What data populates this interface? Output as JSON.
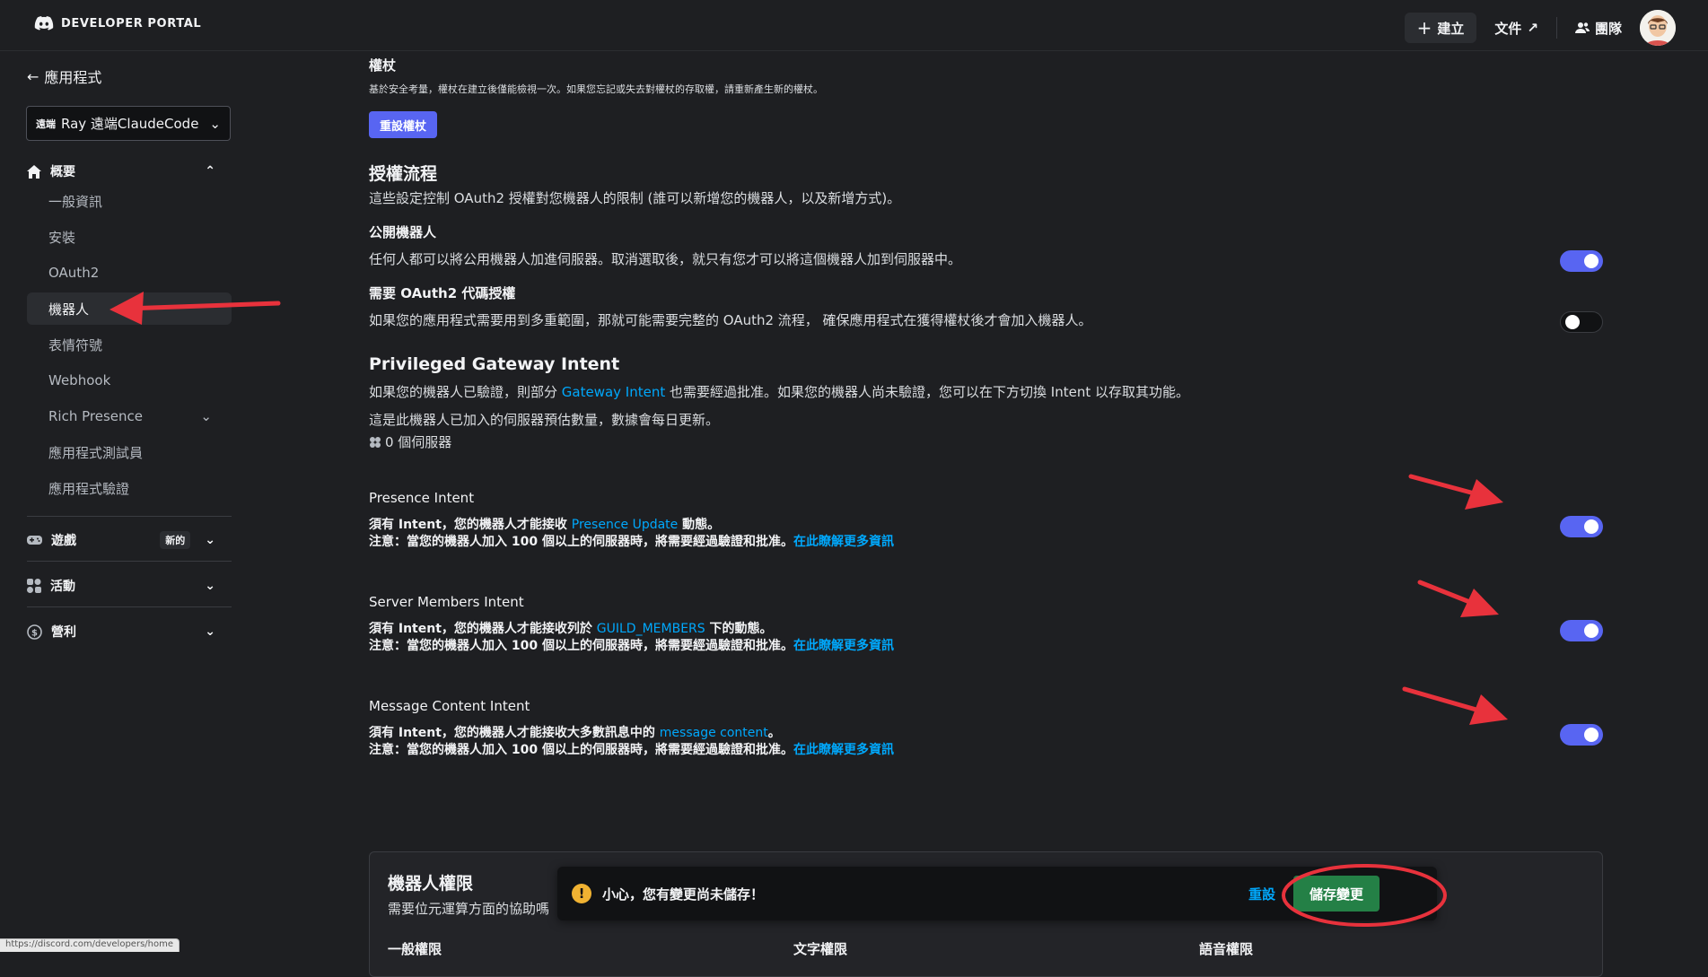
{
  "header": {
    "brand": "DEVELOPER PORTAL",
    "create_label": "建立",
    "docs_label": "文件",
    "team_label": "團隊"
  },
  "sidebar": {
    "back_label": "應用程式",
    "app_selector": {
      "prefix": "遠端",
      "name": "Ray 遠端ClaudeCode"
    },
    "overview_heading": "概要",
    "items": [
      {
        "label": "一般資訊"
      },
      {
        "label": "安裝"
      },
      {
        "label": "OAuth2"
      },
      {
        "label": "機器人"
      },
      {
        "label": "表情符號"
      },
      {
        "label": "Webhook"
      },
      {
        "label": "Rich Presence"
      },
      {
        "label": "應用程式測試員"
      },
      {
        "label": "應用程式驗證"
      }
    ],
    "games_heading": "遊戲",
    "games_badge": "新的",
    "activities_heading": "活動",
    "monetization_heading": "營利"
  },
  "main": {
    "token": {
      "title": "權杖",
      "desc": "基於安全考量，權杖在建立後僅能檢視一次。如果您忘記或失去對權杖的存取權，請重新產生新的權杖。",
      "reset_button": "重設權杖"
    },
    "auth_flow": {
      "title": "授權流程",
      "desc": "這些設定控制 OAuth2 授權對您機器人的限制 (誰可以新增您的機器人，以及新增方式)。"
    },
    "public_bot": {
      "title": "公開機器人",
      "desc": "任何人都可以將公用機器人加進伺服器。取消選取後，就只有您才可以將這個機器人加到伺服器中。",
      "enabled": true
    },
    "oauth2_grant": {
      "title": "需要 OAuth2 代碼授權",
      "desc": "如果您的應用程式需要用到多重範圍，那就可能需要完整的 OAuth2 流程， 確保應用程式在獲得權杖後才會加入機器人。",
      "enabled": false
    },
    "privileged": {
      "title": "Privileged Gateway Intent",
      "desc_before": "如果您的機器人已驗證，則部分 ",
      "desc_link": "Gateway Intent",
      "desc_after": " 也需要經過批准。如果您的機器人尚未驗證，您可以在下方切換 Intent 以存取其功能。",
      "estimate": "這是此機器人已加入的伺服器預估數量，數據會每日更新。",
      "server_count": "0 個伺服器"
    },
    "intents": [
      {
        "title": "Presence Intent",
        "line1_before": "須有 Intent，您的機器人才能接收 ",
        "line1_link": "Presence Update",
        "line1_after": " 動態。",
        "note": "注意：當您的機器人加入 100 個以上的伺服器時，將需要經過驗證和批准。",
        "learn_more": "在此瞭解更多資訊",
        "enabled": true
      },
      {
        "title": "Server Members Intent",
        "line1_before": "須有 Intent，您的機器人才能接收列於 ",
        "line1_link": "GUILD_MEMBERS",
        "line1_after": " 下的動態。",
        "note": "注意：當您的機器人加入 100 個以上的伺服器時，將需要經過驗證和批准。",
        "learn_more": "在此瞭解更多資訊",
        "enabled": true
      },
      {
        "title": "Message Content Intent",
        "line1_before": "須有 Intent，您的機器人才能接收大多數訊息中的 ",
        "line1_link": "message content",
        "line1_after": "。",
        "note": "注意：當您的機器人加入 100 個以上的伺服器時，將需要經過驗證和批准。",
        "learn_more": "在此瞭解更多資訊",
        "enabled": true
      }
    ],
    "permissions": {
      "title": "機器人權限",
      "desc": "需要位元運算方面的協助嗎",
      "col_general": "一般權限",
      "col_text": "文字權限",
      "col_voice": "語音權限"
    }
  },
  "unsaved_notice": {
    "message": "小心，您有變更尚未儲存！",
    "reset_label": "重設",
    "save_label": "儲存變更"
  },
  "status_bar": {
    "url": "https://discord.com/developers/home"
  },
  "colors": {
    "background": "#1e1f22",
    "blurple": "#5865f2",
    "link": "#00a8fc",
    "save_green": "#248046",
    "annotation_red": "#e8323c"
  }
}
